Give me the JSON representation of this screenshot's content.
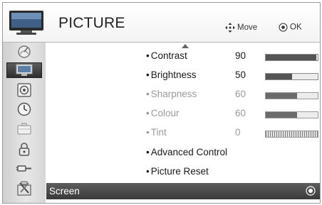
{
  "header": {
    "title": "PICTURE",
    "move_hint": "Move",
    "ok_hint": "OK",
    "icon": "tv-icon"
  },
  "sidebar": {
    "items": [
      {
        "icon": "satellite-dish-icon",
        "active": false
      },
      {
        "icon": "tv-picture-icon",
        "active": true
      },
      {
        "icon": "speaker-icon",
        "active": false
      },
      {
        "icon": "clock-icon",
        "active": false
      },
      {
        "icon": "briefcase-icon",
        "active": false
      },
      {
        "icon": "lock-icon",
        "active": false
      },
      {
        "icon": "input-plug-icon",
        "active": false
      },
      {
        "icon": "tools-icon",
        "active": false
      }
    ]
  },
  "menu": {
    "items": [
      {
        "label": "Contrast",
        "value": "90",
        "level": 0.97,
        "enabled": true
      },
      {
        "label": "Brightness",
        "value": "50",
        "level": 0.5,
        "enabled": true
      },
      {
        "label": "Sharpness",
        "value": "60",
        "level": 0.6,
        "enabled": false
      },
      {
        "label": "Colour",
        "value": "60",
        "level": 0.6,
        "enabled": false
      },
      {
        "label": "Tint",
        "value": "0",
        "level": 0.5,
        "enabled": false
      },
      {
        "label": "Advanced Control",
        "enabled": true
      },
      {
        "label": "Picture Reset",
        "enabled": true
      }
    ],
    "selected": {
      "label": "Screen"
    }
  },
  "colors": {
    "selected_bg": "#444444",
    "bar_fill": "#555555",
    "disabled_text": "#9a9a9a"
  }
}
